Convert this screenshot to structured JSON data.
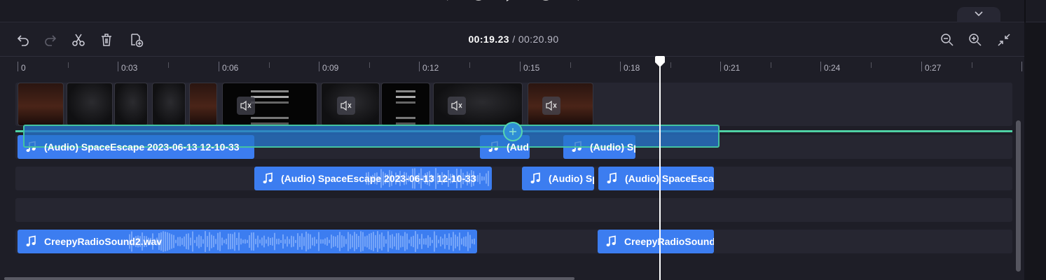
{
  "toolbar": {
    "undo": "undo-icon",
    "redo": "redo-icon",
    "split": "scissors-icon",
    "delete": "trash-icon",
    "add_clip": "add-clip-icon",
    "zoom_out": "zoom-out-icon",
    "zoom_in": "zoom-in-icon",
    "fit": "collapse-arrows-icon"
  },
  "timecode": {
    "current": "00:19.23",
    "separator": " / ",
    "duration": "00:20.90"
  },
  "ruler": {
    "labels": [
      "0",
      "0:03",
      "0:06",
      "0:09",
      "0:12",
      "0:15",
      "0:18",
      "0:21",
      "0:24",
      "0:27"
    ]
  },
  "tracks": {
    "audio1": [
      {
        "label": "(Audio) SpaceEscape 2023-06-13 12-10-33"
      },
      {
        "label": "(Aud"
      },
      {
        "label": "(Audio) Sp"
      }
    ],
    "audio2": [
      {
        "label": "(Audio) SpaceEscape 2023-06-13 12-10-33"
      },
      {
        "label": "(Audio) Sp"
      },
      {
        "label": "(Audio) SpaceEscap"
      }
    ],
    "audio4": [
      {
        "label": "CreepyRadioSound2.wav"
      },
      {
        "label": "CreepyRadioSound"
      }
    ]
  },
  "colors": {
    "clip": "#3c7df0",
    "insert_line": "#4fd1a5",
    "background": "#1e1e27"
  }
}
